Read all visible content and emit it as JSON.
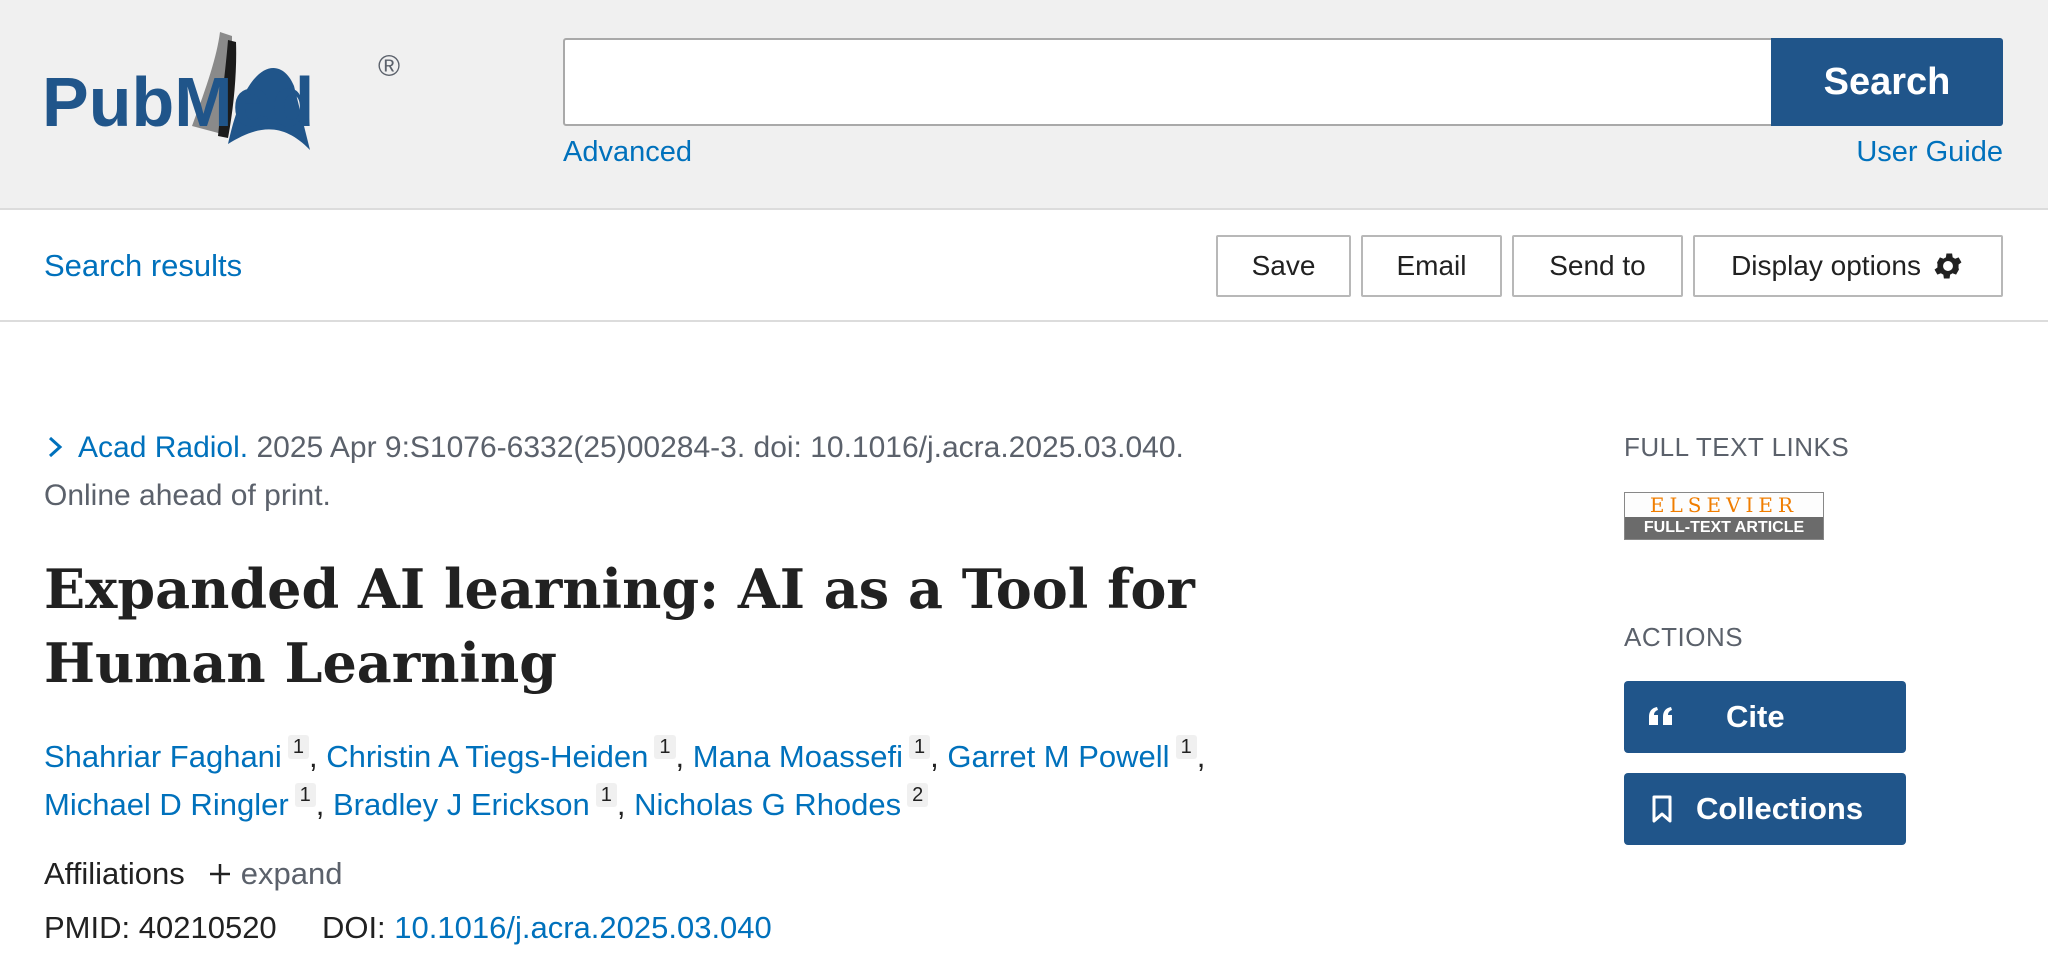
{
  "header": {
    "logo_text": "PubMed",
    "logo_mark": "®",
    "search_placeholder": "",
    "search_value": "",
    "search_label": "Search",
    "advanced_label": "Advanced",
    "user_guide_label": "User Guide"
  },
  "toolbar": {
    "search_results_label": "Search results",
    "save_label": "Save",
    "email_label": "Email",
    "send_to_label": "Send to",
    "display_options_label": "Display options"
  },
  "article": {
    "journal": "Acad Radiol.",
    "citation": "2025 Apr 9:S1076-6332(25)00284-3. doi: 10.1016/j.acra.2025.03.040.",
    "status": "Online ahead of print.",
    "title": "Expanded AI learning: AI as a Tool for Human Learning",
    "authors": [
      {
        "name": "Shahriar Faghani",
        "aff": "1"
      },
      {
        "name": "Christin A Tiegs-Heiden",
        "aff": "1"
      },
      {
        "name": "Mana Moassefi",
        "aff": "1"
      },
      {
        "name": "Garret M Powell",
        "aff": "1"
      },
      {
        "name": "Michael D Ringler",
        "aff": "1"
      },
      {
        "name": "Bradley J Erickson",
        "aff": "1"
      },
      {
        "name": "Nicholas G Rhodes",
        "aff": "2"
      }
    ],
    "affiliations_label": "Affiliations",
    "expand_label": "expand",
    "pmid_label": "PMID:",
    "pmid": "40210520",
    "doi_label": "DOI:",
    "doi": "10.1016/j.acra.2025.03.040"
  },
  "sidebar": {
    "full_text_links_heading": "FULL TEXT LINKS",
    "elsevier_top": "ELSEVIER",
    "elsevier_bottom": "FULL-TEXT ARTICLE",
    "actions_heading": "ACTIONS",
    "cite_label": "Cite",
    "collections_label": "Collections"
  },
  "colors": {
    "brand_blue": "#20558a",
    "link_blue": "#0071bc",
    "header_bg": "#f0f0f0"
  },
  "icons": [
    "gear-icon",
    "chevron-right-icon",
    "plus-icon",
    "quote-icon",
    "bookmark-icon"
  ]
}
